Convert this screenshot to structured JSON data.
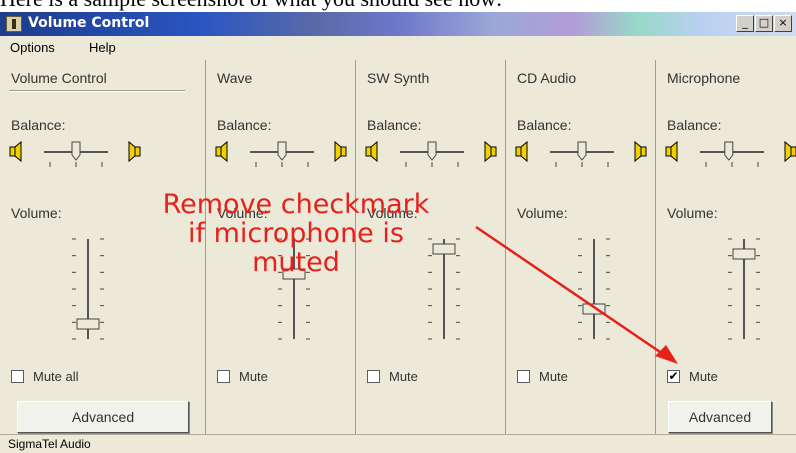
{
  "caption": "Here is a sample screenshot of what you should see now:",
  "window": {
    "title": "Volume Control"
  },
  "title_buttons": {
    "minimize": "_",
    "maximize": "□",
    "close": "×"
  },
  "menu": [
    "Options",
    "Help"
  ],
  "common": {
    "balance_label": "Balance:",
    "volume_label": "Volume:"
  },
  "channels": [
    {
      "name": "Volume Control",
      "mute_label": "Mute all",
      "muted": false,
      "advanced": "Advanced",
      "balance": 0.5,
      "volume": 0.15
    },
    {
      "name": "Wave",
      "mute_label": "Mute",
      "muted": false,
      "balance": 0.5,
      "volume": 0.65
    },
    {
      "name": "SW Synth",
      "mute_label": "Mute",
      "muted": false,
      "balance": 0.5,
      "volume": 0.9
    },
    {
      "name": "CD Audio",
      "mute_label": "Mute",
      "muted": false,
      "balance": 0.5,
      "volume": 0.3
    },
    {
      "name": "Microphone",
      "mute_label": "Mute",
      "muted": true,
      "advanced": "Advanced",
      "balance": 0.45,
      "volume": 0.85
    }
  ],
  "check_mark": "✔",
  "status_bar": "SigmaTel Audio",
  "annotation": {
    "line1": "Remove checkmark",
    "line2": "if microphone is",
    "line3": "muted",
    "color": "#e6211c"
  }
}
